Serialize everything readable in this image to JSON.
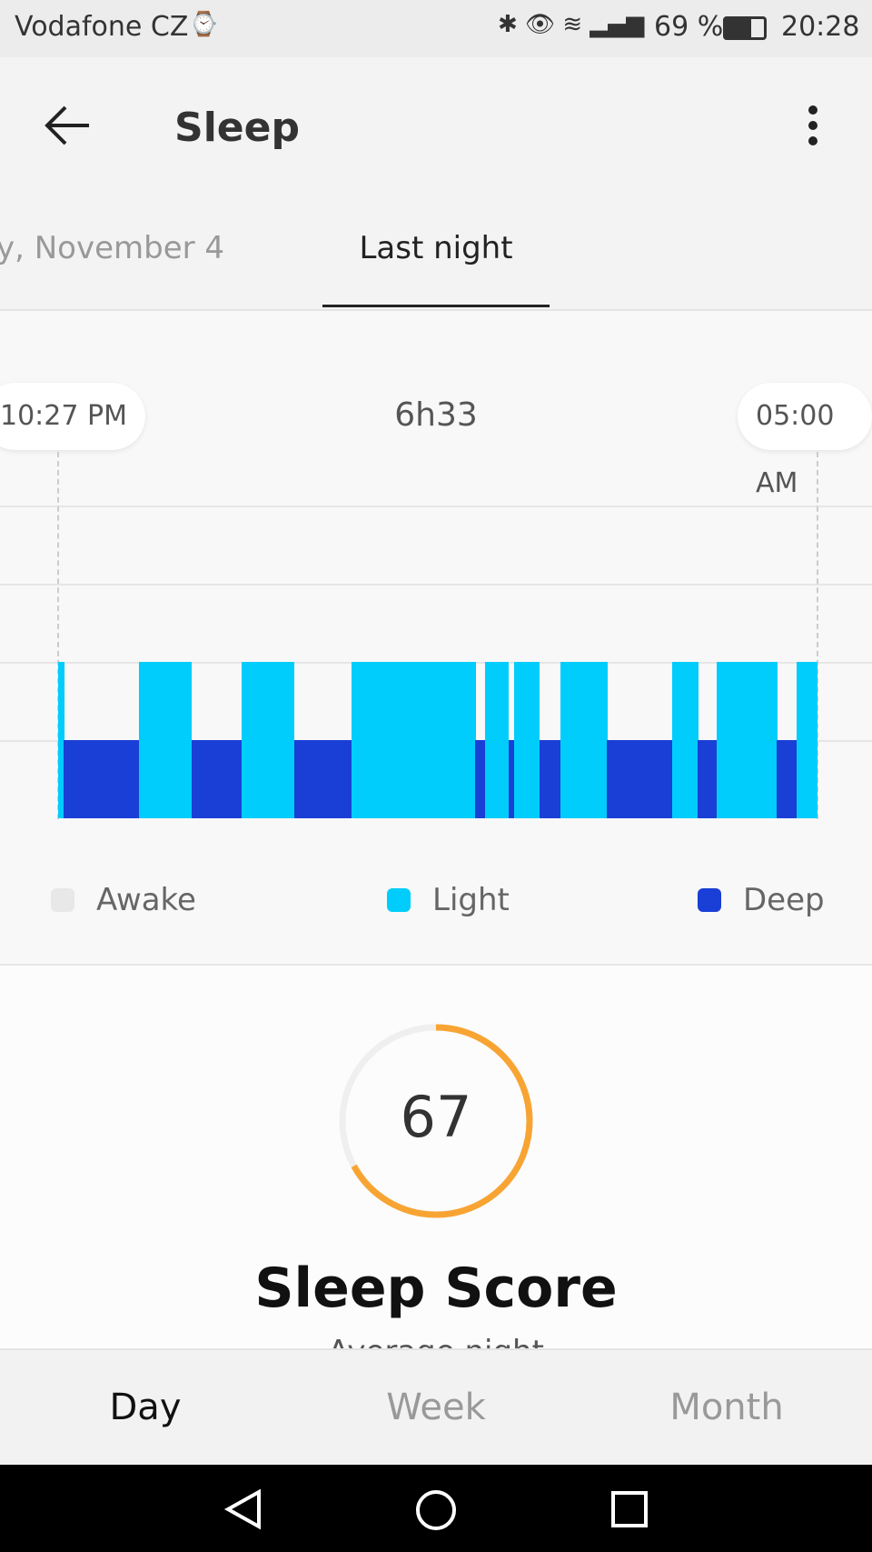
{
  "status": {
    "carrier": "Vodafone CZ",
    "battery": "69 %",
    "time": "20:28"
  },
  "header": {
    "title": "Sleep"
  },
  "tabs": [
    {
      "label": "y, November 4",
      "active": false
    },
    {
      "label": "Last night",
      "active": true
    }
  ],
  "chart_data": {
    "type": "timeline",
    "start_label": "10:27 PM",
    "end_label": "05:00 AM",
    "duration": "6h33",
    "stage_colors": {
      "Awake": "#e8e8e8",
      "Light": "#00cdfc",
      "Deep": "#1a3fd6"
    },
    "segments": [
      [
        "Light",
        3
      ],
      [
        "Deep",
        39
      ],
      [
        "Light",
        27
      ],
      [
        "Deep",
        26
      ],
      [
        "Light",
        27
      ],
      [
        "Deep",
        30
      ],
      [
        "Light",
        64
      ],
      [
        "Deep",
        5
      ],
      [
        "Light",
        12
      ],
      [
        "Deep",
        3
      ],
      [
        "Light",
        13
      ],
      [
        "Deep",
        11
      ],
      [
        "Light",
        24
      ],
      [
        "Deep",
        34
      ],
      [
        "Light",
        13
      ],
      [
        "Deep",
        10
      ],
      [
        "Light",
        31
      ],
      [
        "Deep",
        10
      ],
      [
        "Light",
        11
      ]
    ],
    "segment_units": "minutes (approx.)"
  },
  "legend": [
    {
      "label": "Awake",
      "color": "#e8e8e8"
    },
    {
      "label": "Light",
      "color": "#00cdfc"
    },
    {
      "label": "Deep",
      "color": "#1a3fd6"
    }
  ],
  "score": {
    "value": "67",
    "percent": 67,
    "label": "Sleep Score",
    "sub": "Average night",
    "color": "#f8a433"
  },
  "bottom_tabs": [
    {
      "label": "Day",
      "active": true
    },
    {
      "label": "Week"
    },
    {
      "label": "Month"
    }
  ]
}
